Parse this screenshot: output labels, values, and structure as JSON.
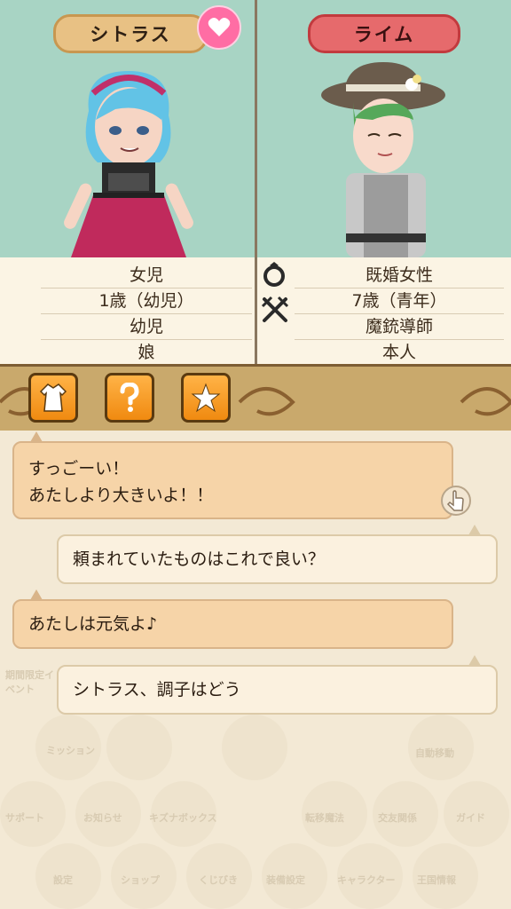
{
  "characters": {
    "left": {
      "name": "シトラス",
      "details": [
        "女児",
        "1歳（幼児）",
        "幼児",
        "娘"
      ]
    },
    "right": {
      "name": "ライム",
      "details": [
        "既婚女性",
        "7歳（青年）",
        "魔銃導師",
        "本人"
      ]
    }
  },
  "icons": {
    "heart": "heart-icon",
    "marriage": "ring-icon",
    "swords": "crossed-swords-icon",
    "outfit": "outfit-icon",
    "question": "question-icon",
    "favorite": "star-icon",
    "touch": "touch-icon"
  },
  "chat": [
    {
      "speaker": "left",
      "lines": [
        "すっごーい！",
        "あたしより大きいよ！！"
      ]
    },
    {
      "speaker": "right",
      "lines": [
        "頼まれていたものはこれで良い？"
      ]
    },
    {
      "speaker": "left",
      "lines": [
        "あたしは元気よ♪"
      ]
    },
    {
      "speaker": "right",
      "lines": [
        "シトラス、調子はどう"
      ]
    }
  ],
  "background_menu": {
    "event": "期間限定イベント",
    "labels": [
      "ミッション",
      "自動移動",
      "サポート",
      "お知らせ",
      "キズナボックス",
      "転移魔法",
      "交友関係",
      "ガイド",
      "設定",
      "ショップ",
      "くじびき",
      "装備設定",
      "キャラクター",
      "王国情報"
    ]
  },
  "colors": {
    "accent_heart": "#ff6da4",
    "name_left_bg": "#e8c184",
    "name_right_bg": "#e66a6c",
    "button_orange": "#f08a10"
  }
}
